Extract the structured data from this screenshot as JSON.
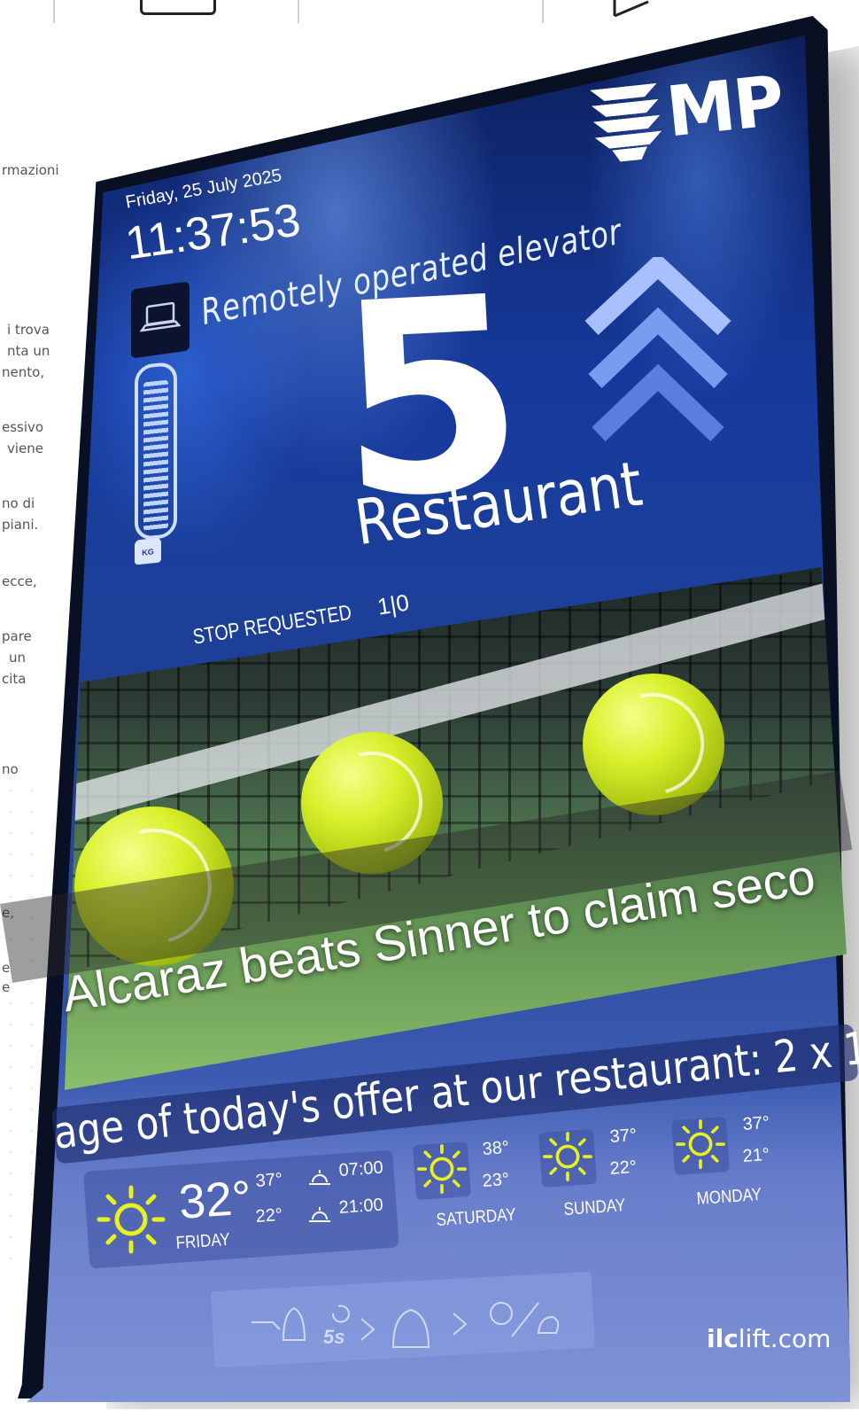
{
  "background_page": {
    "text_fragments": [
      "rmazioni",
      "i trova",
      "nta un",
      "nento,",
      "essivo",
      "viene",
      "no di",
      "piani.",
      "ecce,",
      "pare",
      "un",
      "cita",
      "no",
      "e,",
      "e",
      "e"
    ]
  },
  "display": {
    "logo_text": "MP",
    "date": "Friday, 25 July 2025",
    "time": "11:37:53",
    "status_message": "Remotely operated elevator",
    "floor_number": "5",
    "floor_name": "Restaurant",
    "direction": "up",
    "load_level": 0.95,
    "load_unit": "KG",
    "stop_requested_label": "STOP REQUESTED",
    "stop_requested_count": "1|0",
    "news_caption": "Alcaraz beats Sinner to claim seco",
    "ticker_text": "age of today's offer at our restaurant: 2 x 1",
    "help_delay": "5s"
  },
  "weather": {
    "today": {
      "temp": "32°",
      "max": "37°",
      "min": "22°",
      "sunrise": "07:00",
      "sunset": "21:00",
      "day": "FRIDAY",
      "icon": "sun-icon"
    },
    "forecast": [
      {
        "day": "SATURDAY",
        "max": "38°",
        "min": "23°",
        "icon": "sun-icon"
      },
      {
        "day": "SUNDAY",
        "max": "37°",
        "min": "22°",
        "icon": "sun-icon"
      },
      {
        "day": "MONDAY",
        "max": "37°",
        "min": "21°",
        "icon": "sun-icon"
      }
    ]
  },
  "brand": {
    "bold": "ilc",
    "rest": "lift.com"
  },
  "colors": {
    "screen_blue": "#163a9c",
    "sun_yellow": "#e8f020",
    "arrow_blue": "#7fa6ff"
  }
}
